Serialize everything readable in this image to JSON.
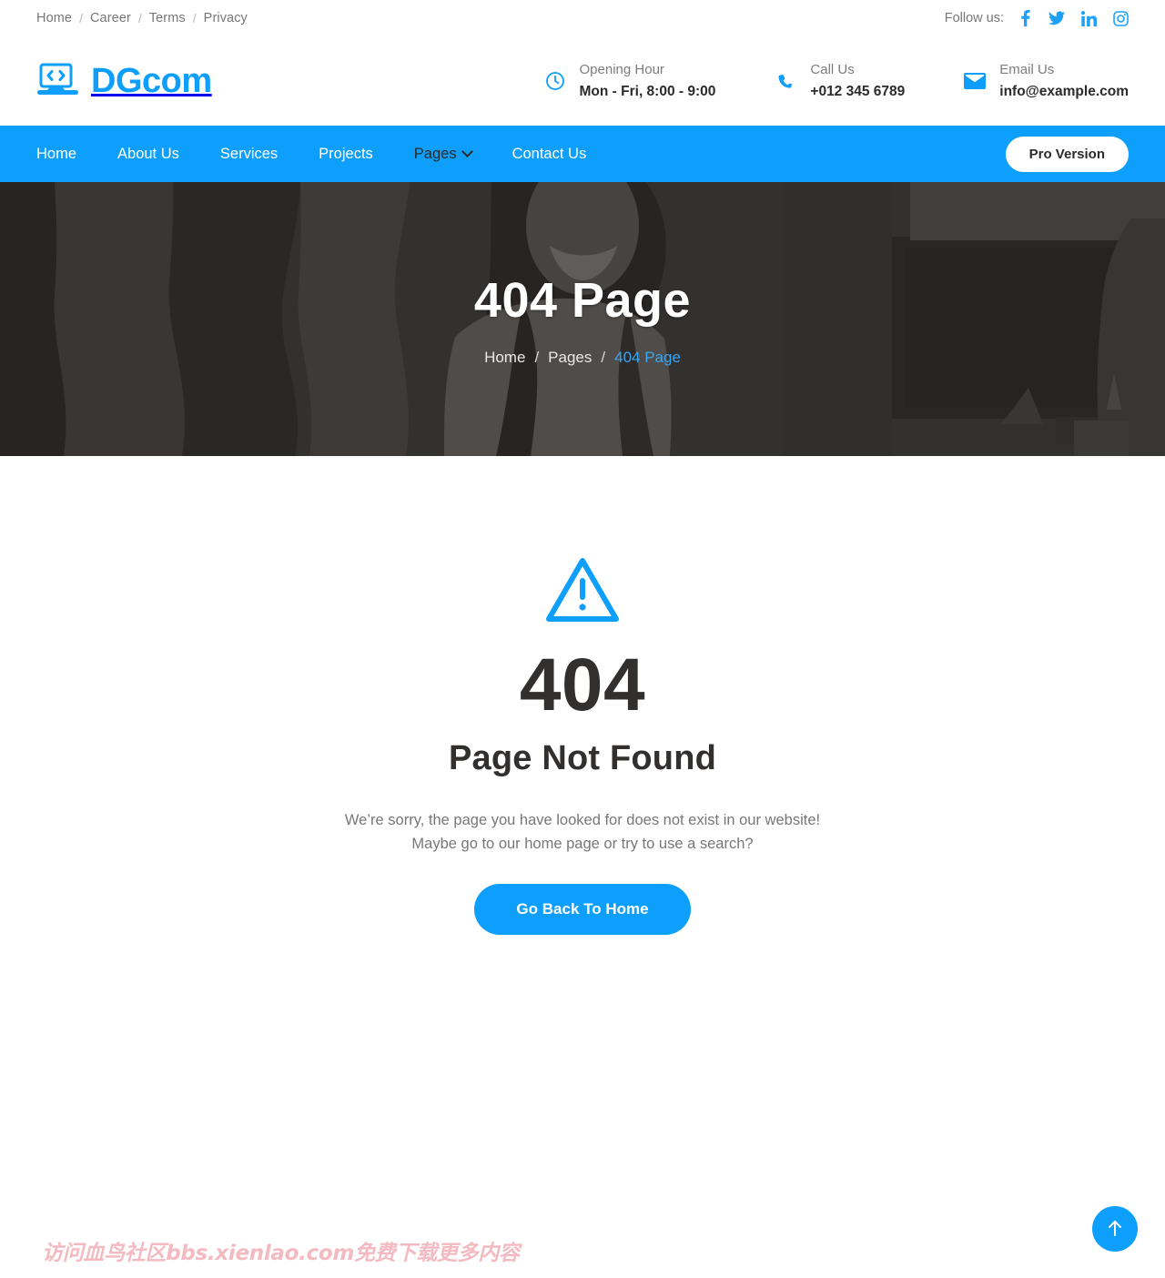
{
  "topbar": {
    "links": [
      {
        "label": "Home"
      },
      {
        "label": "Career"
      },
      {
        "label": "Terms"
      },
      {
        "label": "Privacy"
      }
    ],
    "separator": "/",
    "follow_label": "Follow us:",
    "socials": [
      {
        "name": "facebook-icon",
        "label": "Facebook"
      },
      {
        "name": "twitter-icon",
        "label": "Twitter"
      },
      {
        "name": "linkedin-icon",
        "label": "LinkedIn"
      },
      {
        "name": "instagram-icon",
        "label": "Instagram"
      }
    ]
  },
  "header": {
    "brand_name": "DGcom",
    "brand_icon": "laptop-code-icon",
    "info": [
      {
        "icon": "clock-icon",
        "label": "Opening Hour",
        "value": "Mon - Fri, 8:00 - 9:00"
      },
      {
        "icon": "phone-icon",
        "label": "Call Us",
        "value": "+012 345 6789"
      },
      {
        "icon": "envelope-icon",
        "label": "Email Us",
        "value": "info@example.com"
      }
    ]
  },
  "nav": {
    "items": [
      {
        "label": "Home",
        "active": false,
        "dropdown": false
      },
      {
        "label": "About Us",
        "active": false,
        "dropdown": false
      },
      {
        "label": "Services",
        "active": false,
        "dropdown": false
      },
      {
        "label": "Projects",
        "active": false,
        "dropdown": false
      },
      {
        "label": "Pages",
        "active": true,
        "dropdown": true
      },
      {
        "label": "Contact Us",
        "active": false,
        "dropdown": false
      }
    ],
    "cta_label": "Pro Version"
  },
  "hero": {
    "title": "404 Page",
    "breadcrumb": [
      {
        "label": "Home",
        "current": false
      },
      {
        "label": "Pages",
        "current": false
      },
      {
        "label": "404 Page",
        "current": true
      }
    ],
    "separator": "/"
  },
  "main": {
    "icon": "warning-triangle-icon",
    "code": "404",
    "heading": "Page Not Found",
    "message_line1": "We’re sorry, the page you have looked for does not exist in our website!",
    "message_line2": "Maybe go to our home page or try to use a search?",
    "button_label": "Go Back To Home"
  },
  "footer": {
    "watermark": "访问血鸟社区bbs.xienlao.com免费下载更多内容",
    "back_to_top_icon": "arrow-up-icon"
  },
  "colors": {
    "accent": "#0d9ffb",
    "nav_bg": "#0d9ffb",
    "text_dark": "#32302f",
    "text_muted": "#777777",
    "hero_bg": "#3a3734",
    "watermark": "#f0a8b0"
  }
}
